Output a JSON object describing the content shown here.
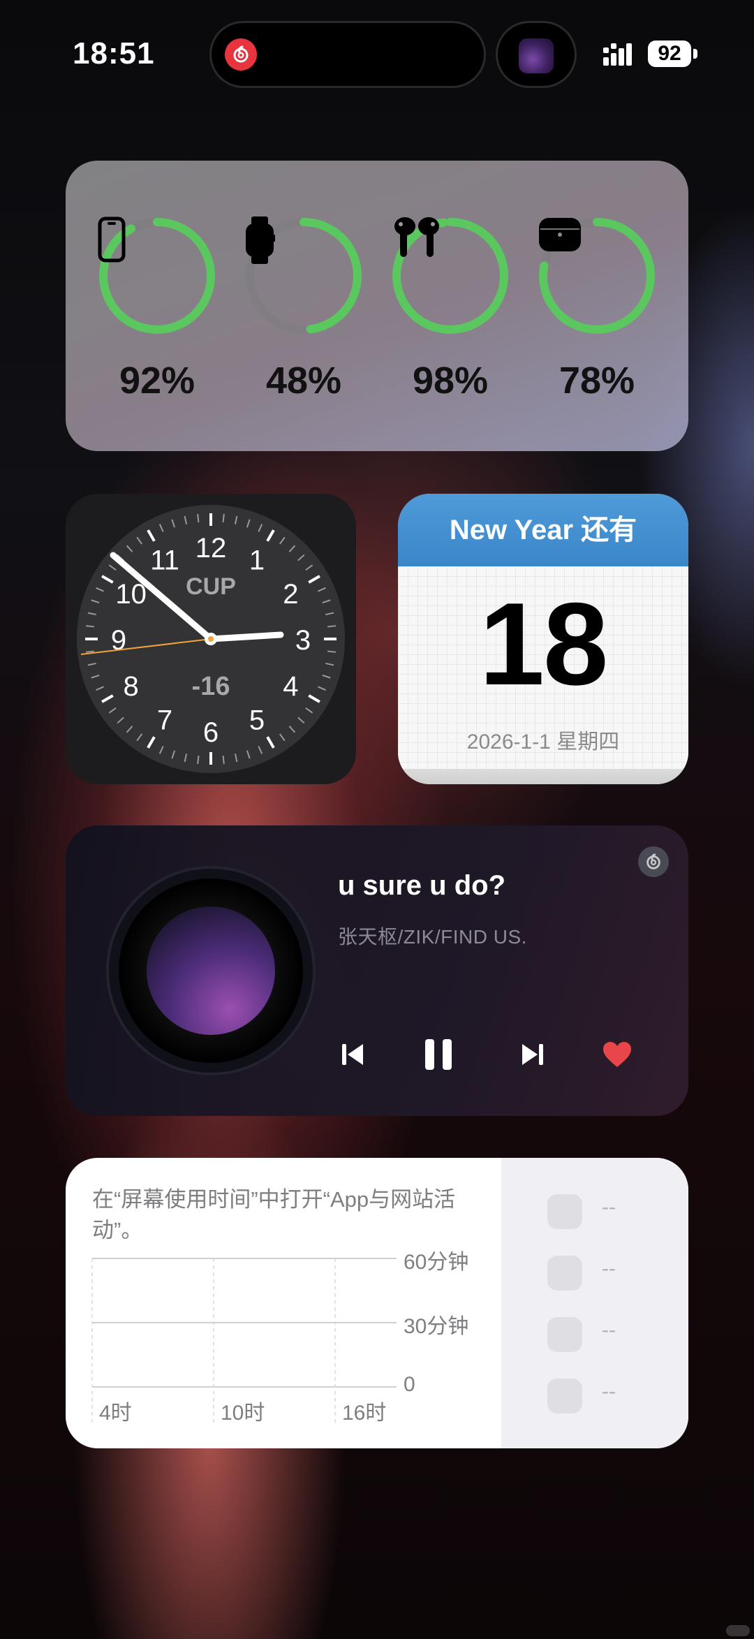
{
  "status_bar": {
    "time": "18:51",
    "battery": "92"
  },
  "batteries": [
    {
      "device": "iPhone",
      "icon": "phone-icon",
      "percent": "92%",
      "level": 0.92
    },
    {
      "device": "Watch",
      "icon": "watch-icon",
      "percent": "48%",
      "level": 0.48
    },
    {
      "device": "AirPods",
      "icon": "airpods-icon",
      "percent": "98%",
      "level": 0.98
    },
    {
      "device": "AirPods Case",
      "icon": "airpods-case-icon",
      "percent": "78%",
      "level": 0.78
    }
  ],
  "clock": {
    "city": "CUP",
    "offset": "-16",
    "numerals": [
      "12",
      "1",
      "2",
      "3",
      "4",
      "5",
      "6",
      "7",
      "8",
      "9",
      "10",
      "11"
    ]
  },
  "calendar": {
    "header": "New Year 还有",
    "days": "18",
    "date": "2026-1-1 星期四"
  },
  "music": {
    "title": "u sure u do?",
    "artist": "张天枢/ZIK/FIND US."
  },
  "screen_time": {
    "message": "在“屏幕使用时间”中打开“App与网站活动”。",
    "y_labels": [
      "60分钟",
      "30分钟",
      "0"
    ],
    "x_labels": [
      "4时",
      "10时",
      "16时"
    ],
    "rows": [
      "--",
      "--",
      "--",
      "--"
    ]
  },
  "colors": {
    "ring_green": "#5ac85f",
    "ring_track": "#7b7b7d",
    "calendar_blue": "#428fd0",
    "heart_red": "#e8464a",
    "netease_red": "#e8343d"
  }
}
